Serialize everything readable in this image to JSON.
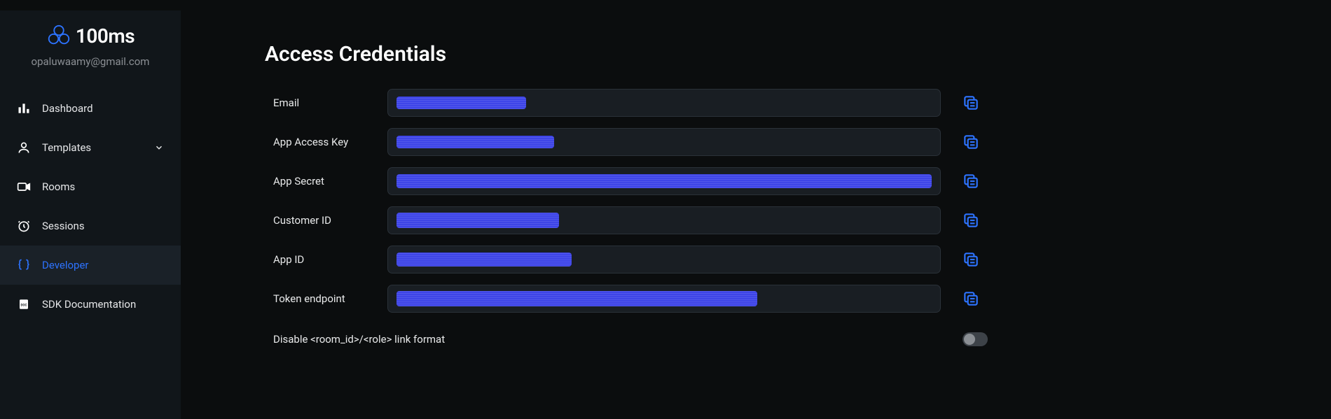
{
  "brand": {
    "name": "100ms"
  },
  "user": {
    "email": "opaluwaamy@gmail.com"
  },
  "sidebar": {
    "items": [
      {
        "label": "Dashboard"
      },
      {
        "label": "Templates"
      },
      {
        "label": "Rooms"
      },
      {
        "label": "Sessions"
      },
      {
        "label": "Developer"
      },
      {
        "label": "SDK Documentation"
      }
    ]
  },
  "page": {
    "title": "Access Credentials"
  },
  "credentials": [
    {
      "label": "Email"
    },
    {
      "label": "App Access Key"
    },
    {
      "label": "App Secret"
    },
    {
      "label": "Customer ID"
    },
    {
      "label": "App ID"
    },
    {
      "label": "Token endpoint"
    }
  ],
  "settings": {
    "disable_link_label": "Disable <room_id>/<role> link format"
  }
}
